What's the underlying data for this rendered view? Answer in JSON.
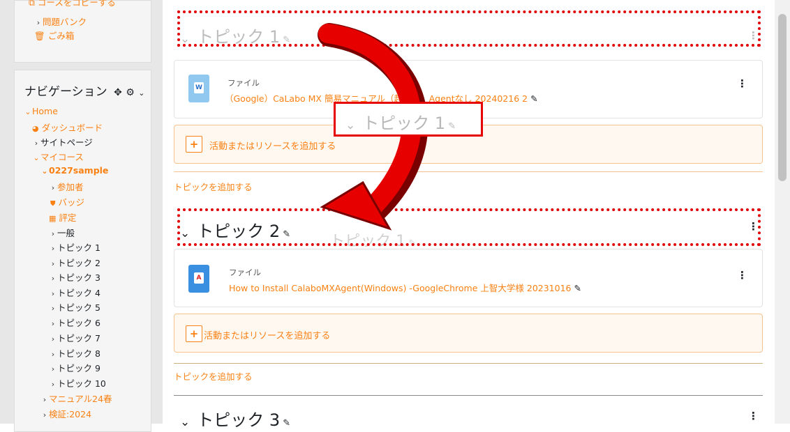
{
  "sidebar": {
    "admin_items": [
      {
        "label": "コースをコピーする"
      },
      {
        "label": "問題バンク"
      },
      {
        "label": "ごみ箱"
      }
    ],
    "nav_title": "ナビゲーション",
    "nav_items": [
      {
        "label": "Home"
      },
      {
        "label": "ダッシュボード"
      },
      {
        "label": "サイトページ"
      },
      {
        "label": "マイコース"
      },
      {
        "label": "0227sample"
      },
      {
        "label": "参加者"
      },
      {
        "label": "バッジ"
      },
      {
        "label": "評定"
      },
      {
        "label": "一般"
      },
      {
        "label": "トピック 1"
      },
      {
        "label": "トピック 2"
      },
      {
        "label": "トピック 3"
      },
      {
        "label": "トピック 4"
      },
      {
        "label": "トピック 5"
      },
      {
        "label": "トピック 6"
      },
      {
        "label": "トピック 7"
      },
      {
        "label": "トピック 8"
      },
      {
        "label": "トピック 9"
      },
      {
        "label": "トピック 10"
      },
      {
        "label": "マニュアル24春"
      },
      {
        "label": "検証:2024"
      }
    ]
  },
  "main": {
    "section1": {
      "title": "トピック 1",
      "file_type": "ファイル",
      "file_name": "（Google）CaLabo MX 簡易マニュアル（起動編）Agentなし 20240216 2"
    },
    "drag_ghost_title": "トピック 1",
    "add_activity": "活動またはリソースを追加する",
    "add_topic": "トピックを追加する",
    "section2": {
      "title": "トピック 2",
      "file_type": "ファイル",
      "file_name": "How to Install CalaboMXAgent(Windows) -GoogleChrome 上智大学様 20231016"
    },
    "section3": {
      "title": "トピック 3"
    }
  },
  "colors": {
    "accent": "#f98012",
    "annotation": "#e00000"
  }
}
